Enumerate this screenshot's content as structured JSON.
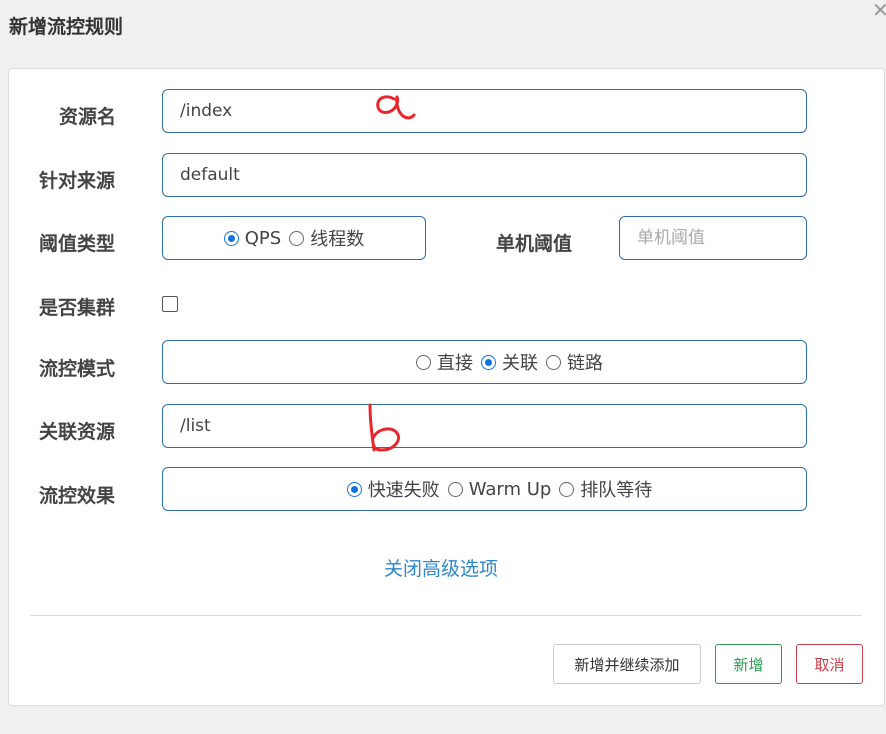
{
  "dialog": {
    "title": "新增流控规则",
    "close_symbol": "✕"
  },
  "form": {
    "resource_name": {
      "label": "资源名",
      "value": "/index"
    },
    "source": {
      "label": "针对来源",
      "value": "default"
    },
    "threshold_type": {
      "label": "阈值类型",
      "options": [
        {
          "label": "QPS",
          "selected": true
        },
        {
          "label": "线程数",
          "selected": false
        }
      ]
    },
    "single_threshold": {
      "label": "单机阈值",
      "placeholder": "单机阈值"
    },
    "cluster": {
      "label": "是否集群",
      "checked": false
    },
    "flow_mode": {
      "label": "流控模式",
      "options": [
        {
          "label": "直接",
          "selected": false
        },
        {
          "label": "关联",
          "selected": true
        },
        {
          "label": "链路",
          "selected": false
        }
      ]
    },
    "related_resource": {
      "label": "关联资源",
      "value": "/list"
    },
    "flow_effect": {
      "label": "流控效果",
      "options": [
        {
          "label": "快速失败",
          "selected": true
        },
        {
          "label": "Warm Up",
          "selected": false
        },
        {
          "label": "排队等待",
          "selected": false
        }
      ]
    },
    "advanced_toggle": "关闭高级选项"
  },
  "buttons": {
    "add_continue": "新增并继续添加",
    "add": "新增",
    "cancel": "取消"
  },
  "colors": {
    "accent": "#0b74e0",
    "input_border": "#2f6fa8",
    "link": "#2e87c8",
    "add_green": "#2e9a52",
    "cancel_red": "#c9404b",
    "annotation_red": "#e8262b"
  }
}
